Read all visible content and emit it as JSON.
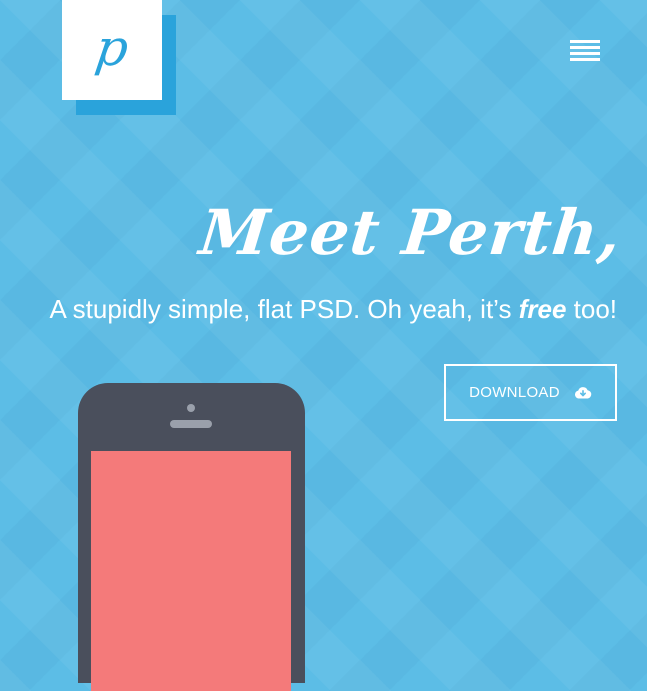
{
  "logo": {
    "letter": "p",
    "icon": "logo-p-icon"
  },
  "nav": {
    "menu_icon": "hamburger-menu-icon"
  },
  "hero": {
    "headline": "Meet Perth,",
    "tagline_before": "A stupidly simple, flat PSD. Oh yeah, it’s ",
    "tagline_emphasis": "free",
    "tagline_after": " too!",
    "download_label": "DOWNLOAD",
    "download_icon": "cloud-download-icon"
  },
  "illustration": {
    "device": "phone-mockup",
    "screen_color": "#f47a7a",
    "body_color": "#4a4f5c"
  },
  "colors": {
    "background": "#5cbde6",
    "accent": "#2aa3db",
    "text": "#ffffff"
  }
}
